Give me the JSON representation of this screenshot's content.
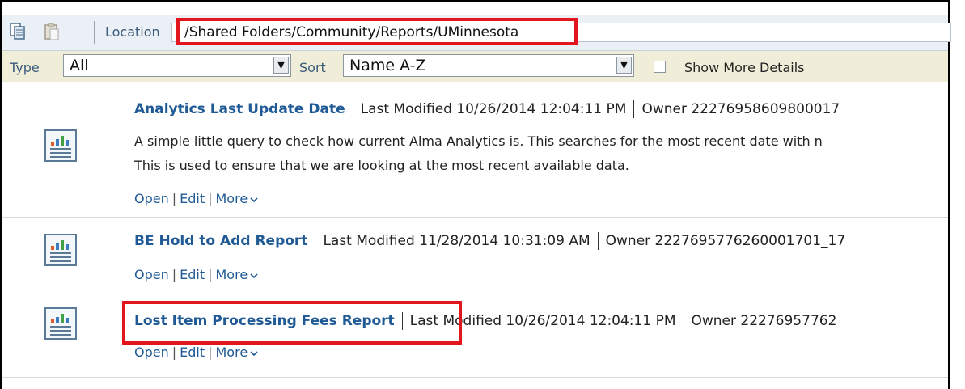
{
  "toolbar": {
    "location_label": "Location",
    "location_value": "/Shared Folders/Community/Reports/UMinnesota"
  },
  "filters": {
    "type_label": "Type",
    "type_value": "All",
    "sort_label": "Sort",
    "sort_value": "Name A-Z",
    "show_more_label": "Show More Details",
    "show_more_checked": false
  },
  "reports": [
    {
      "title": "Analytics Last Update Date",
      "modified": "Last Modified 10/26/2014 12:04:11 PM",
      "owner": "Owner 22276958609800017",
      "description_1": "A simple little query to check how current Alma Analytics is. This searches for the most recent date with n",
      "description_2": "This is used to ensure that we are looking at the most recent available data.",
      "open": "Open",
      "edit": "Edit",
      "more": "More"
    },
    {
      "title": "BE Hold to Add Report",
      "modified": "Last Modified 11/28/2014 10:31:09 AM",
      "owner": "Owner 2227695776260001701_17",
      "open": "Open",
      "edit": "Edit",
      "more": "More"
    },
    {
      "title": "Lost Item Processing Fees Report",
      "modified": "Last Modified 10/26/2014 12:04:11 PM",
      "owner": "Owner 22276957762",
      "open": "Open",
      "edit": "Edit",
      "more": "More"
    }
  ],
  "colors": {
    "highlight": "#e3161e",
    "link": "#1f5a96",
    "toolbar_bg": "#eaf0f5",
    "filter_bg": "#f0eed8"
  }
}
